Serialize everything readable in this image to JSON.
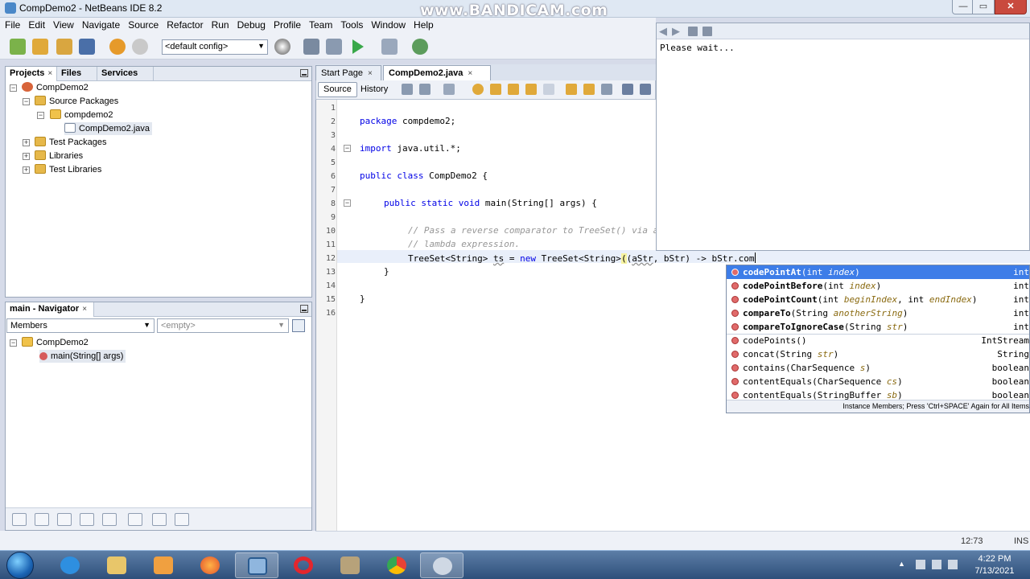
{
  "window": {
    "title": "CompDemo2 - NetBeans IDE 8.2",
    "watermark": "www.BANDICAM.com",
    "min_label": "—",
    "max_label": "▭",
    "close_label": "✕"
  },
  "menu": [
    "File",
    "Edit",
    "View",
    "Navigate",
    "Source",
    "Refactor",
    "Run",
    "Debug",
    "Profile",
    "Team",
    "Tools",
    "Window",
    "Help"
  ],
  "toolbar": {
    "config_value": "<default config>"
  },
  "projects_panel": {
    "tabs": [
      "Projects",
      "Files",
      "Services"
    ],
    "tab_close": "×",
    "tree": [
      {
        "label": "CompDemo2"
      },
      {
        "label": "Source Packages"
      },
      {
        "label": "compdemo2"
      },
      {
        "label": "CompDemo2.java"
      },
      {
        "label": "Test Packages"
      },
      {
        "label": "Libraries"
      },
      {
        "label": "Test Libraries"
      }
    ]
  },
  "navigator_panel": {
    "title": "main - Navigator",
    "tab_close": "×",
    "members_select": "Members",
    "filter_select": "<empty>",
    "tree": [
      {
        "label": "CompDemo2"
      },
      {
        "label": "main(String[] args)"
      }
    ]
  },
  "editor": {
    "tabs": [
      "Start Page",
      "CompDemo2.java"
    ],
    "tab_close": "×",
    "source_button": "Source",
    "history_button": "History",
    "line_numbers": [
      "1",
      "2",
      "3",
      "4",
      "5",
      "6",
      "7",
      "8",
      "9",
      "10",
      "11",
      "12",
      "13",
      "14",
      "15",
      "16"
    ],
    "code": {
      "l2_kw": "package",
      "l2_rest": " compdemo2;",
      "l4_kw": "import",
      "l4_rest": " java.util.*;",
      "l6_kw": "public class",
      "l6_rest": " CompDemo2 {",
      "l8_kw": "public static void",
      "l8_rest": " main(String[] args) {",
      "l10": "// Pass a reverse comparator to TreeSet() via a",
      "l11": "// lambda expression.",
      "l12_a": "TreeSet<String> ",
      "l12_var": "ts",
      "l12_b": " = ",
      "l12_kw": "new",
      "l12_c": " TreeSet<String>",
      "l12_paren": "(",
      "l12_d": "(",
      "l12_astr": "aStr",
      "l12_e": ", bStr) -> bStr.com",
      "l13": "}",
      "l15": "}"
    }
  },
  "doc_popup": {
    "text": "Please wait..."
  },
  "completion": {
    "items": [
      {
        "name": "codePointAt",
        "open": "(int ",
        "p1": "index",
        "close": ")",
        "ret": "int"
      },
      {
        "name": "codePointBefore",
        "open": "(int ",
        "p1": "index",
        "close": ")",
        "ret": "int"
      },
      {
        "name": "codePointCount",
        "open": "(int ",
        "p1": "beginIndex",
        "mid": ", int ",
        "p2": "endIndex",
        "close": ")",
        "ret": "int"
      },
      {
        "name": "compareTo",
        "open": "(String ",
        "p1": "anotherString",
        "close": ")",
        "ret": "int"
      },
      {
        "name": "compareToIgnoreCase",
        "open": "(String ",
        "p1": "str",
        "close": ")",
        "ret": "int"
      },
      {
        "name": "codePoints",
        "open": "()",
        "close": "",
        "ret": "IntStream"
      },
      {
        "name": "concat",
        "open": "(String ",
        "p1": "str",
        "close": ")",
        "ret": "String"
      },
      {
        "name": "contains",
        "open": "(CharSequence ",
        "p1": "s",
        "close": ")",
        "ret": "boolean"
      },
      {
        "name": "contentEquals",
        "open": "(CharSequence ",
        "p1": "cs",
        "close": ")",
        "ret": "boolean"
      },
      {
        "name": "contentEquals",
        "open": "(StringBuffer ",
        "p1": "sb",
        "close": ")",
        "ret": "boolean"
      }
    ],
    "hint": "Instance Members; Press 'Ctrl+SPACE' Again for All Items"
  },
  "status": {
    "position": "12:73",
    "mode": "INS"
  },
  "taskbar": {
    "time": "4:22 PM",
    "date": "7/13/2021"
  },
  "colors": {
    "accent": "#3d7de8",
    "keyword": "#0000e6",
    "comment": "#969696"
  }
}
